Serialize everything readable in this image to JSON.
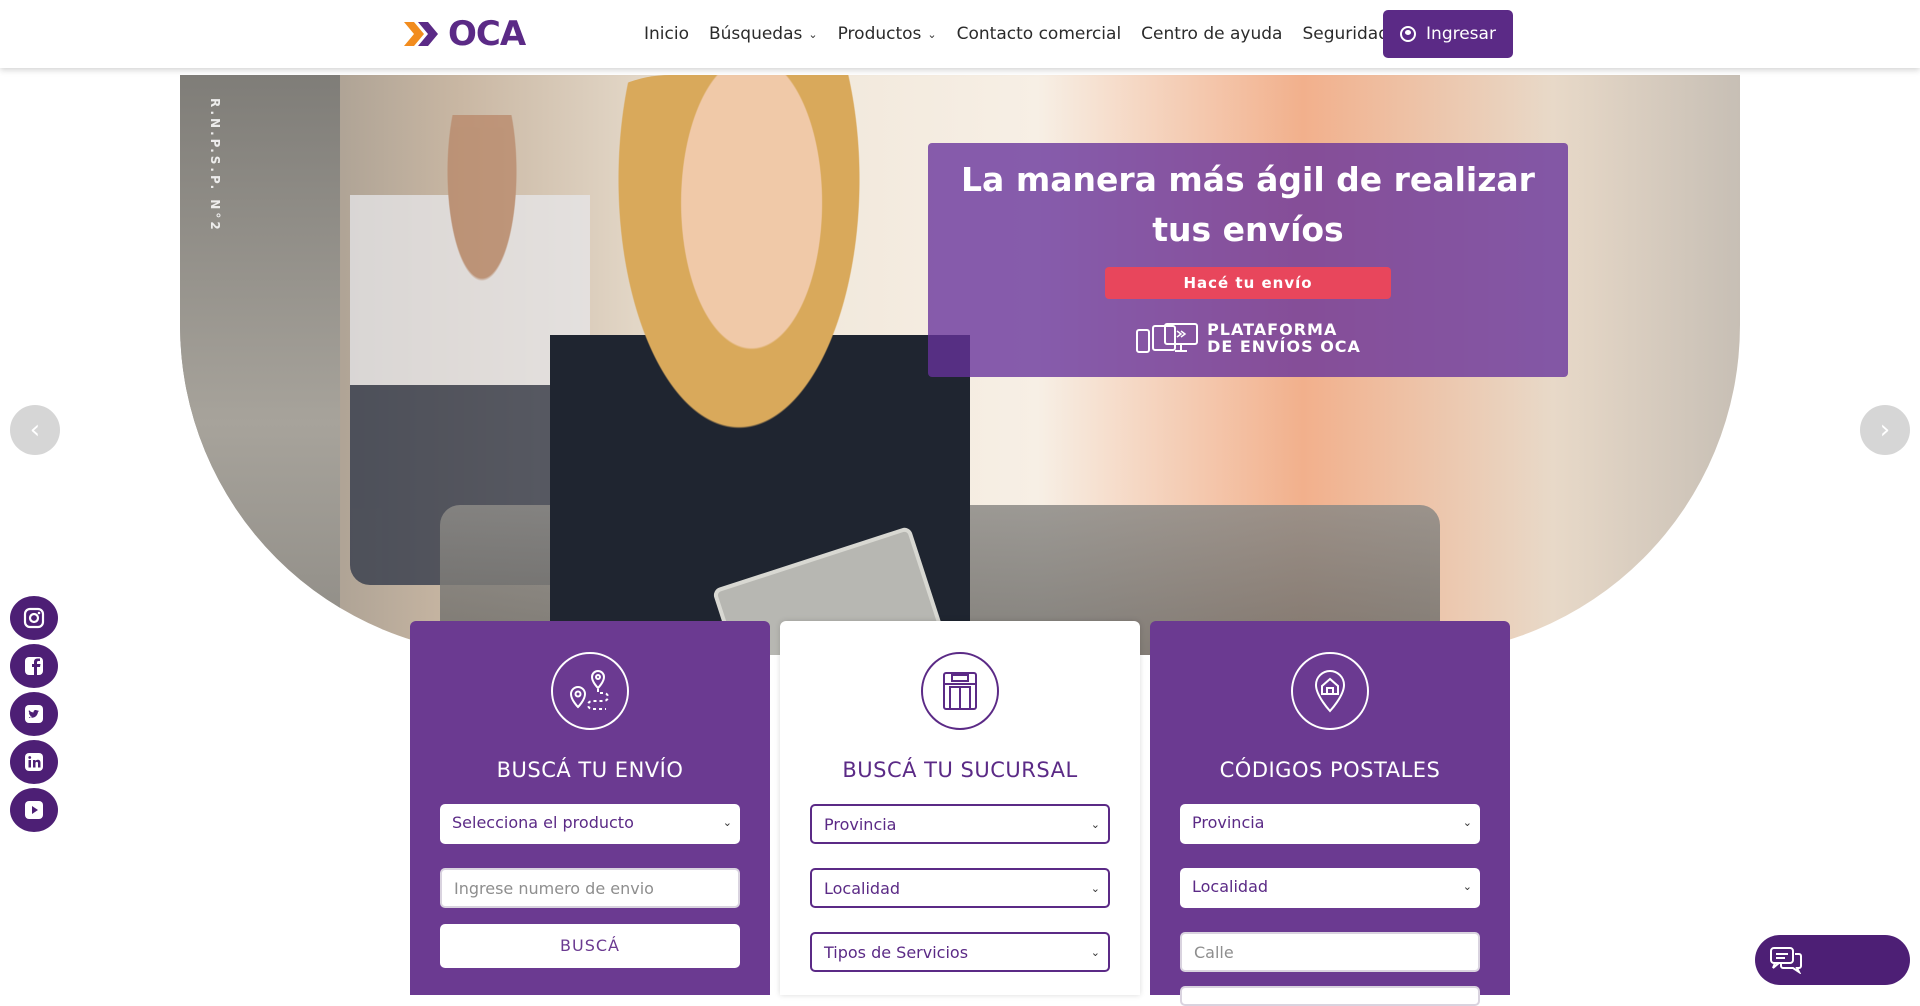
{
  "header": {
    "logo_text": "OCA",
    "nav": [
      "Inicio",
      "Búsquedas",
      "Productos",
      "Contacto comercial",
      "Centro de ayuda",
      "Seguridad"
    ],
    "login_label": "Ingresar"
  },
  "hero": {
    "vertical_text": "R.N.P.S.P. N°2",
    "title": "La manera más ágil de realizar tus envíos",
    "cta_label": "Hacé tu envío",
    "platform_line1": "PLATAFORMA",
    "platform_line2": "DE ENVÍOS OCA",
    "prev_arrow": "‹",
    "next_arrow": "›"
  },
  "social": [
    "instagram-icon",
    "facebook-icon",
    "twitter-icon",
    "linkedin-icon",
    "youtube-icon"
  ],
  "cards": {
    "envio": {
      "title": "BUSCÁ TU ENVÍO",
      "product_select": "Selecciona el producto",
      "tracking_placeholder": "Ingrese numero de envio",
      "search_label": "BUSCÁ"
    },
    "sucursal": {
      "title": "BUSCÁ TU SUCURSAL",
      "province_select": "Provincia",
      "locality_select": "Localidad",
      "services_select": "Tipos de Servicios"
    },
    "postales": {
      "title": "CÓDIGOS POSTALES",
      "province_select": "Provincia",
      "locality_select": "Localidad",
      "street_placeholder": "Calle"
    }
  },
  "colors": {
    "brand_purple": "#5b2a86",
    "card_purple": "#6b3a91",
    "cta_red": "#e8465c",
    "logo_orange": "#f28c1e"
  }
}
